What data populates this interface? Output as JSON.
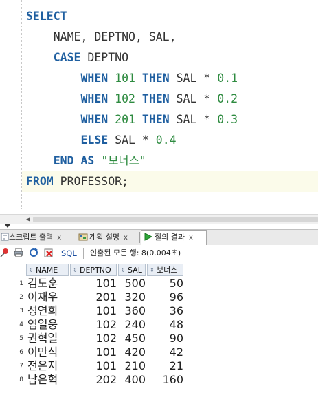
{
  "editor": {
    "lines": [
      [
        {
          "t": "SELECT",
          "c": "kw"
        }
      ],
      [
        {
          "t": "    NAME, DEPTNO, SAL,",
          "c": ""
        }
      ],
      [
        {
          "t": "    ",
          "c": ""
        },
        {
          "t": "CASE",
          "c": "kw"
        },
        {
          "t": " DEPTNO",
          "c": ""
        }
      ],
      [
        {
          "t": "        ",
          "c": ""
        },
        {
          "t": "WHEN",
          "c": "kw"
        },
        {
          "t": " ",
          "c": ""
        },
        {
          "t": "101",
          "c": "num"
        },
        {
          "t": " ",
          "c": ""
        },
        {
          "t": "THEN",
          "c": "kw"
        },
        {
          "t": " SAL * ",
          "c": ""
        },
        {
          "t": "0.1",
          "c": "num"
        }
      ],
      [
        {
          "t": "        ",
          "c": ""
        },
        {
          "t": "WHEN",
          "c": "kw"
        },
        {
          "t": " ",
          "c": ""
        },
        {
          "t": "102",
          "c": "num"
        },
        {
          "t": " ",
          "c": ""
        },
        {
          "t": "THEN",
          "c": "kw"
        },
        {
          "t": " SAL * ",
          "c": ""
        },
        {
          "t": "0.2",
          "c": "num"
        }
      ],
      [
        {
          "t": "        ",
          "c": ""
        },
        {
          "t": "WHEN",
          "c": "kw"
        },
        {
          "t": " ",
          "c": ""
        },
        {
          "t": "201",
          "c": "num"
        },
        {
          "t": " ",
          "c": ""
        },
        {
          "t": "THEN",
          "c": "kw"
        },
        {
          "t": " SAL * ",
          "c": ""
        },
        {
          "t": "0.3",
          "c": "num"
        }
      ],
      [
        {
          "t": "        ",
          "c": ""
        },
        {
          "t": "ELSE",
          "c": "kw"
        },
        {
          "t": " SAL * ",
          "c": ""
        },
        {
          "t": "0.4",
          "c": "num"
        }
      ],
      [
        {
          "t": "    ",
          "c": ""
        },
        {
          "t": "END",
          "c": "kw"
        },
        {
          "t": " ",
          "c": ""
        },
        {
          "t": "AS",
          "c": "kw"
        },
        {
          "t": " ",
          "c": ""
        },
        {
          "t": "\"보너스\"",
          "c": "str"
        }
      ],
      [
        {
          "t": "FROM",
          "c": "kw"
        },
        {
          "t": " PROFESSOR;",
          "c": ""
        }
      ]
    ]
  },
  "tabs": {
    "script_output": "스크립트 출력",
    "explain_plan": "계획 설명",
    "query_result": "질의 결과",
    "close": "x"
  },
  "toolbar": {
    "sql_label": "SQL",
    "fetch_status": "인출된 모든 행: 8(0.004초)"
  },
  "grid": {
    "columns": [
      "NAME",
      "DEPTNO",
      "SAL",
      "보너스"
    ],
    "rows": [
      {
        "num": "1",
        "name": "김도훈",
        "deptno": "101",
        "sal": "500",
        "bonus": "50"
      },
      {
        "num": "2",
        "name": "이재우",
        "deptno": "201",
        "sal": "320",
        "bonus": "96"
      },
      {
        "num": "3",
        "name": "성연희",
        "deptno": "101",
        "sal": "360",
        "bonus": "36"
      },
      {
        "num": "4",
        "name": "염일웅",
        "deptno": "102",
        "sal": "240",
        "bonus": "48"
      },
      {
        "num": "5",
        "name": "권혁일",
        "deptno": "102",
        "sal": "450",
        "bonus": "90"
      },
      {
        "num": "6",
        "name": "이만식",
        "deptno": "101",
        "sal": "420",
        "bonus": "42"
      },
      {
        "num": "7",
        "name": "전은지",
        "deptno": "101",
        "sal": "210",
        "bonus": "21"
      },
      {
        "num": "8",
        "name": "남은혁",
        "deptno": "202",
        "sal": "400",
        "bonus": "160"
      }
    ]
  },
  "colors": {
    "keyword": "#1f5fa0",
    "literal": "#2e8b40",
    "current_line": "#fbfbea"
  }
}
